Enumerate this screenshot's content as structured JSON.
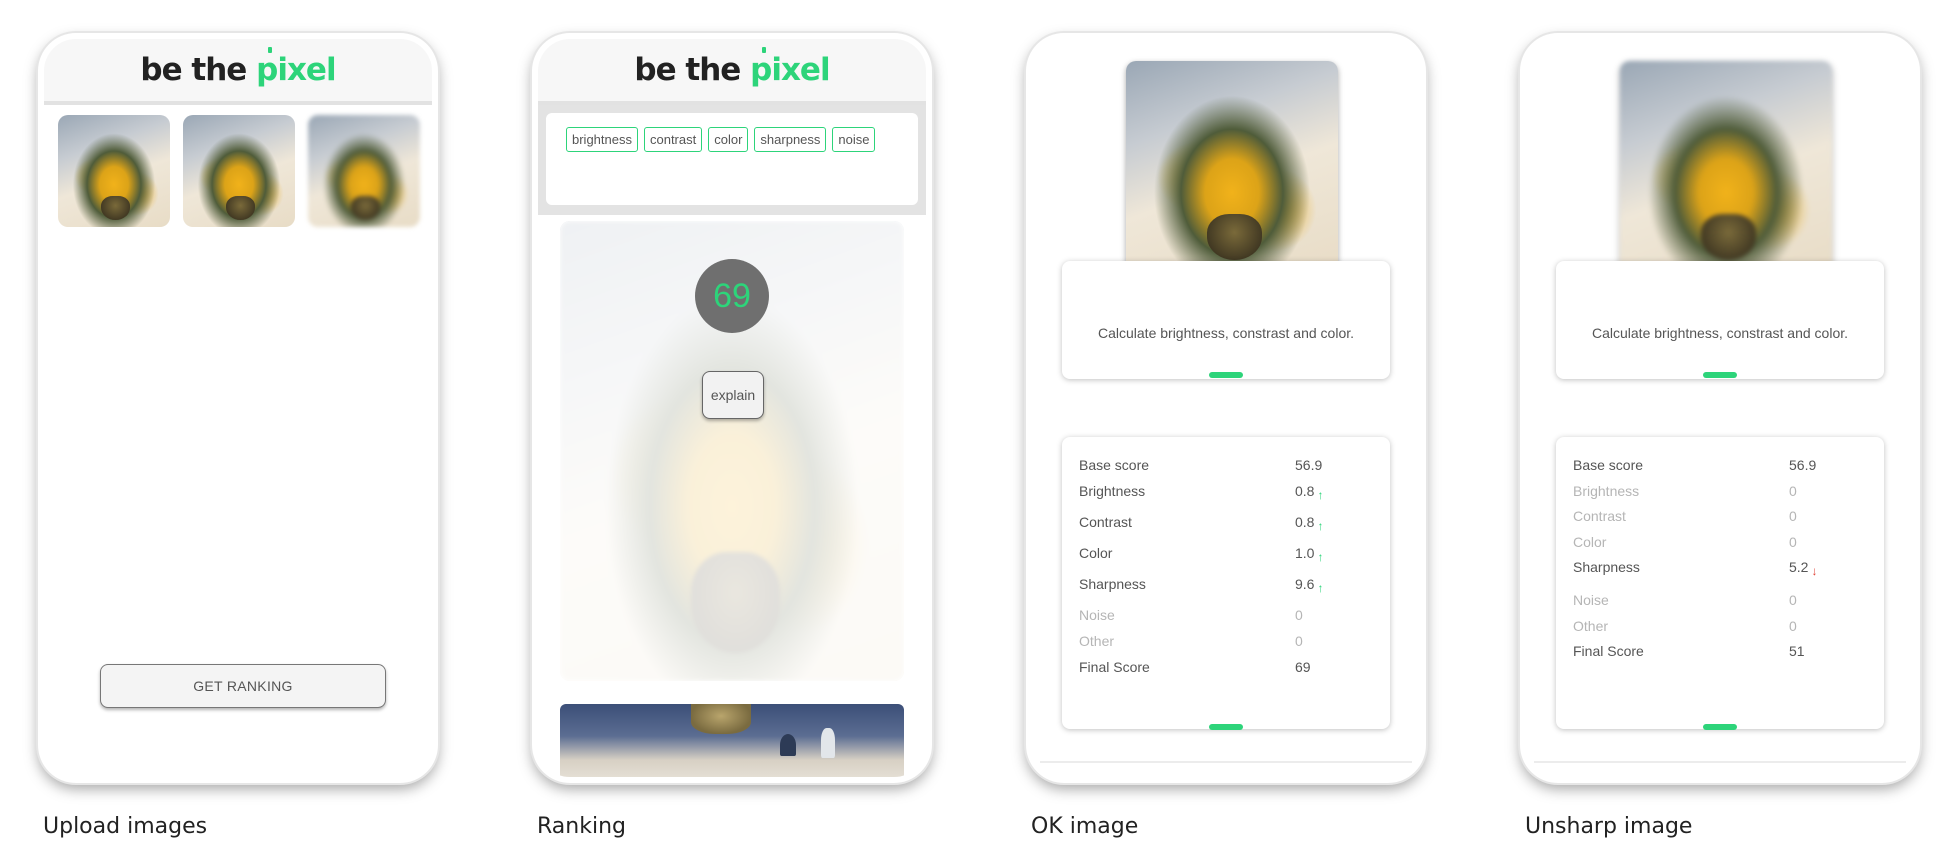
{
  "logo": {
    "part1": "be the ",
    "part2": "pixel"
  },
  "captions": [
    "Upload images",
    "Ranking",
    "OK image",
    "Unsharp image"
  ],
  "upload": {
    "button_label": "GET RANKING"
  },
  "ranking": {
    "tags": [
      "brightness",
      "contrast",
      "color",
      "sharpness",
      "noise"
    ],
    "score": "69",
    "explain_label": "explain"
  },
  "ok_image": {
    "description": "Calculate brightness, constrast and color.",
    "rows": [
      {
        "label": "Base score",
        "value": "56.9",
        "arrow": "",
        "dim": false
      },
      {
        "label": "Brightness",
        "value": "0.8",
        "arrow": "up",
        "dim": false
      },
      {
        "label": "Contrast",
        "value": "0.8",
        "arrow": "up",
        "dim": false
      },
      {
        "label": "Color",
        "value": "1.0",
        "arrow": "up",
        "dim": false
      },
      {
        "label": "Sharpness",
        "value": "9.6",
        "arrow": "up",
        "dim": false
      },
      {
        "label": "Noise",
        "value": "0",
        "arrow": "",
        "dim": true
      },
      {
        "label": "Other",
        "value": "0",
        "arrow": "",
        "dim": true
      },
      {
        "label": "Final Score",
        "value": "69",
        "arrow": "",
        "dim": false
      }
    ]
  },
  "unsharp_image": {
    "description": "Calculate brightness, constrast and color.",
    "rows": [
      {
        "label": "Base score",
        "value": "56.9",
        "arrow": "",
        "dim": false
      },
      {
        "label": "Brightness",
        "value": "0",
        "arrow": "",
        "dim": true
      },
      {
        "label": "Contrast",
        "value": "0",
        "arrow": "",
        "dim": true
      },
      {
        "label": "Color",
        "value": "0",
        "arrow": "",
        "dim": true
      },
      {
        "label": "Sharpness",
        "value": "5.2",
        "arrow": "down",
        "dim": false
      },
      {
        "label": "Noise",
        "value": "0",
        "arrow": "",
        "dim": true
      },
      {
        "label": "Other",
        "value": "0",
        "arrow": "",
        "dim": true
      },
      {
        "label": "Final Score",
        "value": "51",
        "arrow": "",
        "dim": false
      }
    ]
  },
  "icons": {
    "up": "arrow-up-icon",
    "down": "arrow-down-icon"
  },
  "colors": {
    "accent": "#2dd47a",
    "down": "#e0453a"
  }
}
